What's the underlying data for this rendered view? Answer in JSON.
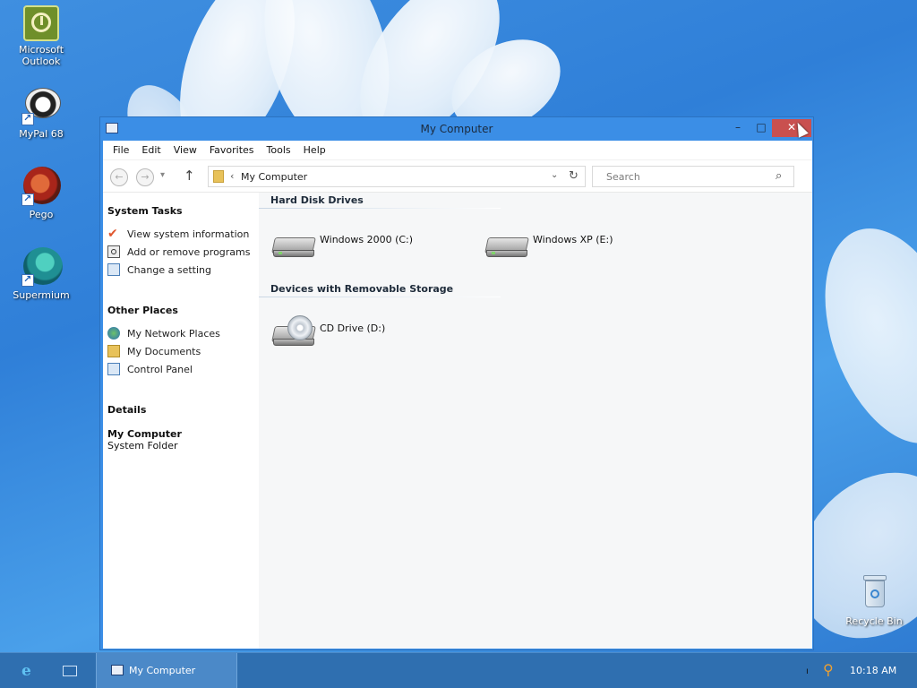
{
  "desktop": {
    "icons": [
      {
        "label": "Microsoft Outlook",
        "icon": "outlook-icon"
      },
      {
        "label": "MyPal 68",
        "icon": "mypal-icon"
      },
      {
        "label": "Pego",
        "icon": "pego-icon"
      },
      {
        "label": "Supermium",
        "icon": "supermium-icon"
      },
      {
        "label": "Recycle Bin",
        "icon": "recycle-bin-icon"
      }
    ]
  },
  "window": {
    "title": "My Computer",
    "close_glyph": "✕",
    "min_glyph": "–",
    "max_glyph": "□"
  },
  "menubar": [
    "File",
    "Edit",
    "View",
    "Favorites",
    "Tools",
    "Help"
  ],
  "address": {
    "chevron": "‹",
    "path": "My Computer",
    "drop_glyph": "⌄",
    "refresh_glyph": "↻"
  },
  "search": {
    "placeholder": "Search",
    "icon_glyph": "⌕"
  },
  "left_pane": {
    "system_tasks": {
      "title": "System Tasks",
      "items": [
        "View system information",
        "Add or remove programs",
        "Change a setting"
      ]
    },
    "other_places": {
      "title": "Other Places",
      "items": [
        "My Network Places",
        "My Documents",
        "Control Panel"
      ]
    },
    "details": {
      "title": "Details",
      "name": "My Computer",
      "type": "System Folder"
    }
  },
  "content": {
    "hard_disks": {
      "title": "Hard Disk Drives",
      "drives": [
        "Windows 2000 (C:)",
        "Windows XP (E:)"
      ]
    },
    "removable": {
      "title": "Devices with Removable Storage",
      "drives": [
        "CD Drive (D:)"
      ]
    }
  },
  "taskbar": {
    "task_label": "My Computer",
    "clock": "10:18 AM",
    "ie_glyph": "e",
    "flag_glyph": "ı"
  },
  "colors": {
    "title_bar": "#3b8ee6",
    "close_button": "#c9504f",
    "taskbar": "#2f6fb0"
  }
}
